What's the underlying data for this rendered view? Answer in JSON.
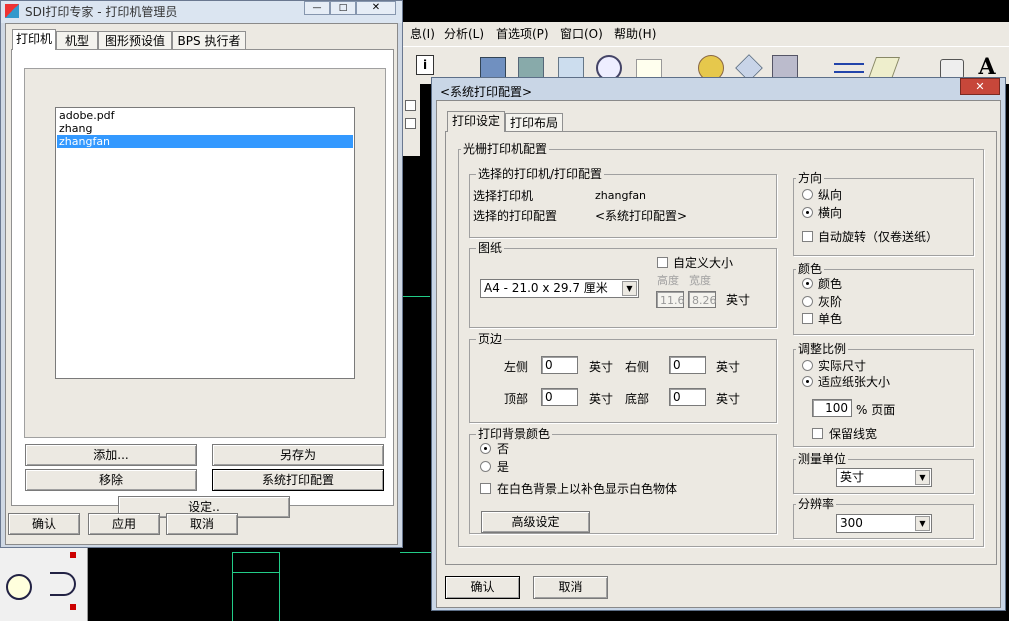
{
  "background_app": {
    "menu": [
      "息(I)",
      "分析(L)",
      "首选项(P)",
      "窗口(O)",
      "帮助(H)"
    ]
  },
  "manager_window": {
    "title": "SDI打印专家 - 打印机管理员",
    "tabs": [
      "打印机",
      "机型",
      "图形预设值",
      "BPS 执行者"
    ],
    "printers": [
      "adobe.pdf",
      "zhang",
      "zhangfan"
    ],
    "selected_printer": "zhangfan",
    "buttons": {
      "add": "添加...",
      "save_as": "另存为",
      "remove": "移除",
      "sys_config": "系统打印配置",
      "setup": "设定..",
      "ok": "确认",
      "apply": "应用",
      "cancel": "取消"
    }
  },
  "config_dialog": {
    "title": "<系统打印配置>",
    "tabs": [
      "打印设定",
      "打印布局"
    ],
    "raster_group": "光栅打印机配置",
    "selected_group": "选择的打印机/打印配置",
    "select_printer_label": "选择打印机",
    "select_printer_value": "zhangfan",
    "select_config_label": "选择的打印配置",
    "select_config_value": "<系统打印配置>",
    "paper_group": "图纸",
    "custom_size": "自定义大小",
    "paper_size": "A4 - 21.0 x 29.7 厘米",
    "height_label": "高度",
    "width_label": "宽度",
    "height_value": "11.6",
    "width_value": "8.26",
    "inch": "英寸",
    "margins_group": "页边",
    "left_label": "左侧",
    "right_label": "右侧",
    "top_label": "顶部",
    "bottom_label": "底部",
    "margin_left": "0",
    "margin_right": "0",
    "margin_top": "0",
    "margin_bottom": "0",
    "bg_color_group": "打印背景颜色",
    "bg_no": "否",
    "bg_yes": "是",
    "white_complement": "在白色背景上以补色显示白色物体",
    "advanced": "高级设定",
    "orientation_group": "方向",
    "portrait": "纵向",
    "landscape": "横向",
    "auto_rotate": "自动旋转（仅卷送纸）",
    "color_group": "颜色",
    "color_color": "颜色",
    "color_gray": "灰阶",
    "color_mono": "单色",
    "scale_group": "调整比例",
    "actual_size": "实际尺寸",
    "fit_paper": "适应纸张大小",
    "scale_value": "100",
    "scale_unit": "% 页面",
    "keep_linewidth": "保留线宽",
    "unit_group": "测量单位",
    "unit_value": "英寸",
    "dpi_group": "分辨率",
    "dpi_value": "300",
    "ok": "确认",
    "cancel": "取消"
  },
  "colors": {
    "dialog_bg": "#ece9e2",
    "selection": "#3399ff",
    "canvas": "#000000"
  }
}
